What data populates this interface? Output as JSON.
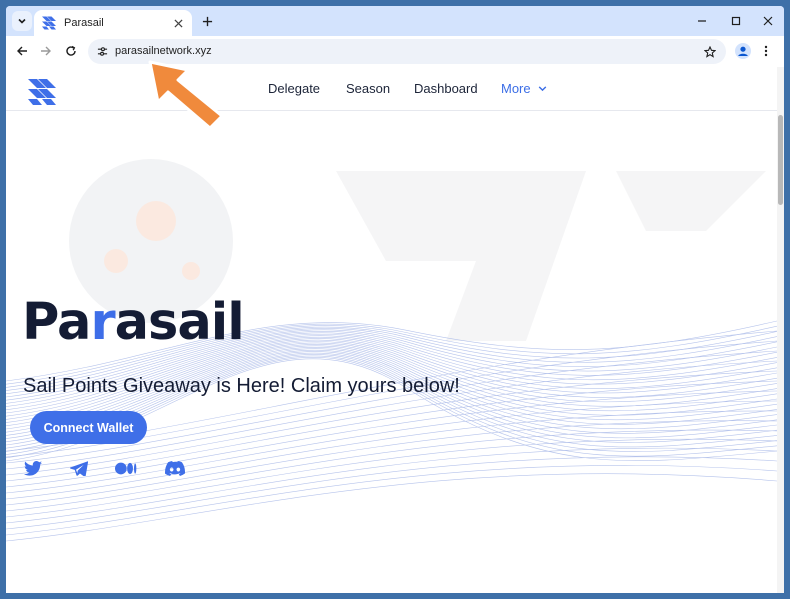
{
  "browser": {
    "tab_title": "Parasail",
    "url": "parasailnetwork.xyz"
  },
  "site": {
    "nav": {
      "delegate": "Delegate",
      "season": "Season",
      "dashboard": "Dashboard",
      "more": "More"
    },
    "hero": {
      "brand_part1": "Pa",
      "brand_accent": "r",
      "brand_part2": "asail",
      "tagline": "Sail Points Giveaway is Here! Claim yours below!",
      "button": "Connect Wallet"
    },
    "social_icons": [
      "twitter-icon",
      "telegram-icon",
      "medium-icon",
      "discord-icon"
    ]
  },
  "colors": {
    "accent": "#3f6fe8",
    "dark": "#141c34",
    "annotation_arrow": "#f08a3c"
  }
}
